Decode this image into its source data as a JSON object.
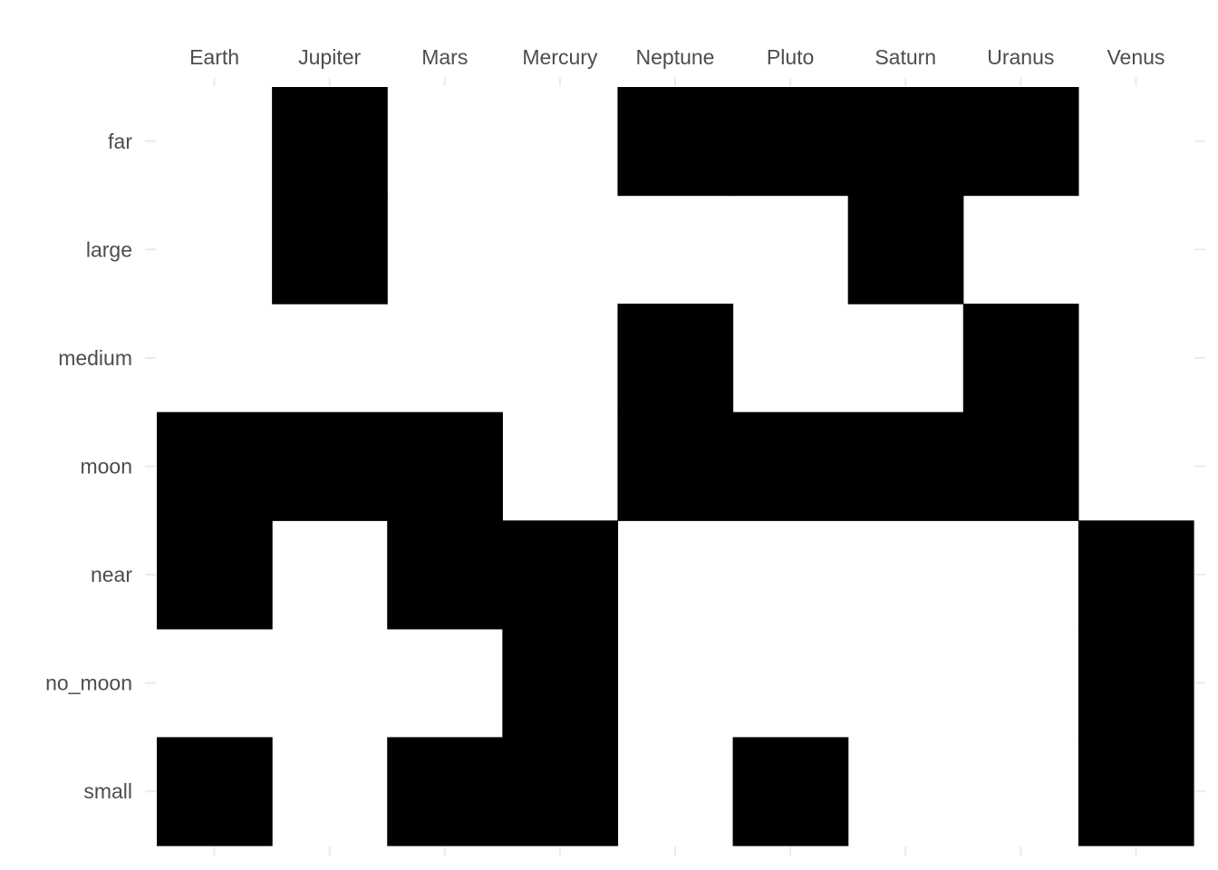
{
  "chart_data": {
    "type": "heatmap",
    "title": "",
    "xlabel": "",
    "ylabel": "",
    "x_axis_position": "top",
    "legend": "none",
    "grid": true,
    "colors": {
      "filled": "#000000",
      "empty": "#ffffff",
      "tick_label": "#4d4d4d",
      "grid": "#ebebeb"
    },
    "x_categories": [
      "Earth",
      "Jupiter",
      "Mars",
      "Mercury",
      "Neptune",
      "Pluto",
      "Saturn",
      "Uranus",
      "Venus"
    ],
    "y_categories": [
      "far",
      "large",
      "medium",
      "moon",
      "near",
      "no_moon",
      "small"
    ],
    "matrix": [
      [
        0,
        1,
        0,
        0,
        1,
        1,
        1,
        1,
        0
      ],
      [
        0,
        1,
        0,
        0,
        0,
        0,
        1,
        0,
        0
      ],
      [
        0,
        0,
        0,
        0,
        1,
        0,
        0,
        1,
        0
      ],
      [
        1,
        1,
        1,
        0,
        1,
        1,
        1,
        1,
        0
      ],
      [
        1,
        0,
        1,
        1,
        0,
        0,
        0,
        0,
        1
      ],
      [
        0,
        0,
        0,
        1,
        0,
        0,
        0,
        0,
        1
      ],
      [
        1,
        0,
        1,
        1,
        0,
        1,
        0,
        0,
        1
      ]
    ]
  }
}
